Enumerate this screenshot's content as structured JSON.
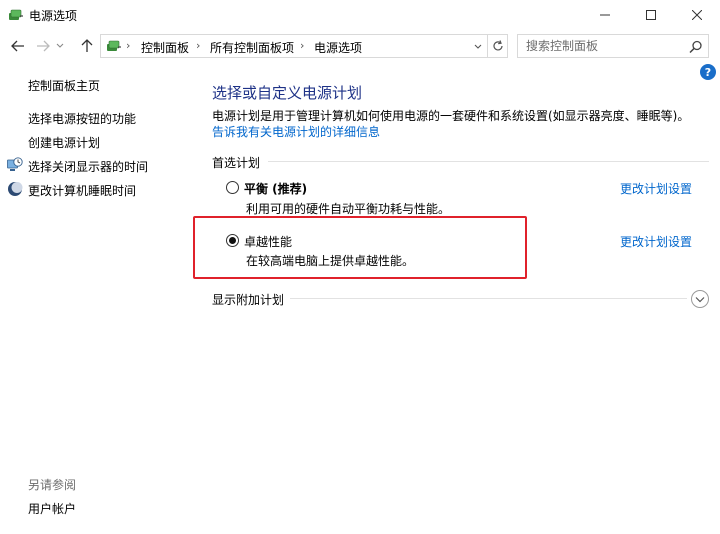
{
  "window": {
    "title": "电源选项",
    "icon": "power-options-icon"
  },
  "nav": {
    "back_icon": "arrow-left-icon",
    "forward_icon": "arrow-right-icon",
    "up_icon": "arrow-up-icon"
  },
  "address": {
    "breadcrumbs": [
      "控制面板",
      "所有控制面板项",
      "电源选项"
    ],
    "separator": "›"
  },
  "search": {
    "placeholder": "搜索控制面板"
  },
  "left_pane": {
    "home": "控制面板主页",
    "tasks": [
      "选择电源按钮的功能",
      "创建电源计划",
      "选择关闭显示器的时间",
      "更改计算机睡眠时间"
    ],
    "see_also_header": "另请参阅",
    "see_also": [
      "用户帐户"
    ]
  },
  "main": {
    "title": "选择或自定义电源计划",
    "description": "电源计划是用于管理计算机如何使用电源的一套硬件和系统设置(如显示器亮度、睡眠等)。",
    "description_link": "告诉我有关电源计划的详细信息",
    "preferred_header": "首选计划",
    "plans": [
      {
        "name": "平衡 (推荐)",
        "desc": "利用可用的硬件自动平衡功耗与性能。",
        "selected": false,
        "link": "更改计划设置"
      },
      {
        "name": "卓越性能",
        "desc": "在较高端电脑上提供卓越性能。",
        "selected": true,
        "link": "更改计划设置"
      }
    ],
    "more_plans": "显示附加计划"
  },
  "colors": {
    "accent": "#1e3287",
    "link": "#0066cc",
    "highlight": "#e0212b"
  }
}
